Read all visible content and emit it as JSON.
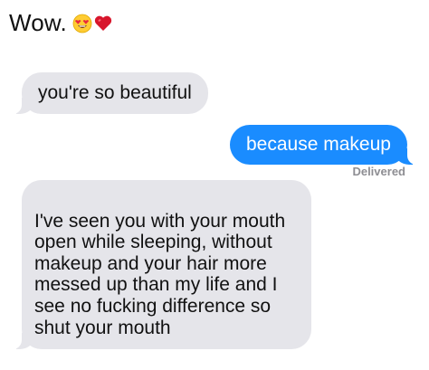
{
  "caption": {
    "text": "Wow.",
    "emojis": [
      "heart-eyes-emoji",
      "red-heart-emoji"
    ]
  },
  "conversation": {
    "messages": [
      {
        "direction": "incoming",
        "text": "you're so beautiful"
      },
      {
        "direction": "outgoing",
        "text": "because makeup"
      },
      {
        "direction": "incoming",
        "text": "I've seen you with your mouth\nopen while sleeping, without\nmakeup and your hair more\nmessed up than my life and I\nsee no fucking difference so\nshut your mouth"
      }
    ],
    "status": "Delivered"
  },
  "colors": {
    "incoming_bubble": "#e5e5ea",
    "outgoing_bubble": "#1a8cff",
    "status_text": "#8e8e93"
  }
}
